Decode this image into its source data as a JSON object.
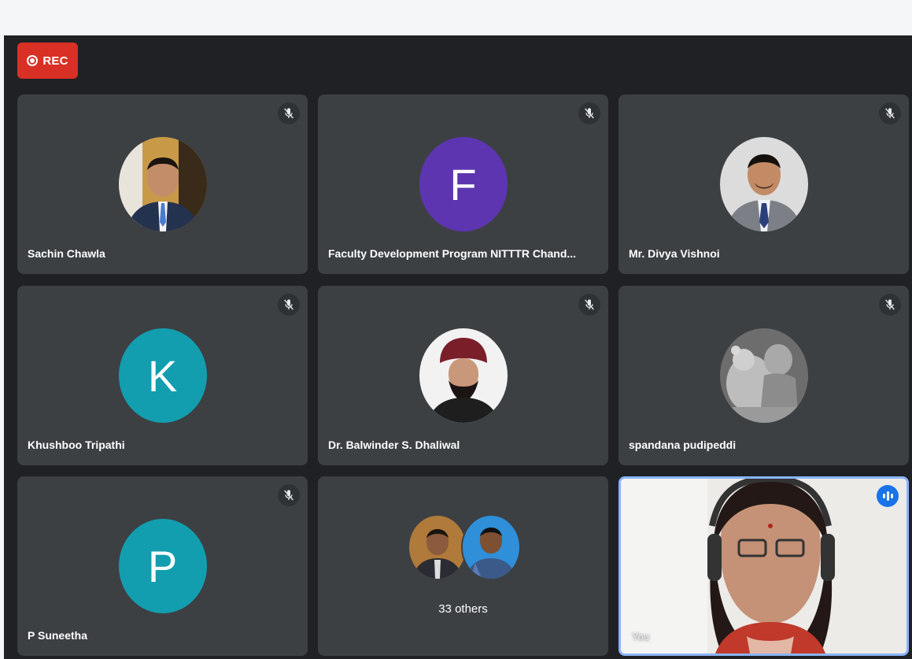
{
  "meeting": {
    "rec_label": "REC"
  },
  "tiles": [
    {
      "name": "Sachin Chawla",
      "type": "photo",
      "muted": true
    },
    {
      "name": "Faculty Development Program NITTTR Chand...",
      "type": "initial",
      "initial": "F",
      "color": "#5e35b1",
      "muted": true
    },
    {
      "name": "Mr. Divya Vishnoi",
      "type": "photo",
      "muted": true
    },
    {
      "name": "Khushboo Tripathi",
      "type": "initial",
      "initial": "K",
      "color": "#129eaf",
      "muted": true
    },
    {
      "name": "Dr. Balwinder S. Dhaliwal",
      "type": "photo",
      "muted": true
    },
    {
      "name": "spandana pudipeddi",
      "type": "photo",
      "muted": true
    },
    {
      "name": "P Suneetha",
      "type": "initial",
      "initial": "P",
      "color": "#129eaf",
      "muted": true
    }
  ],
  "others": {
    "label": "33 others"
  },
  "self": {
    "label": "You",
    "speaking": true
  },
  "colors": {
    "rec": "#d93025",
    "stage": "#202124",
    "tile": "#3c4043",
    "self_border": "#8ab4f8",
    "speaking": "#1a73e8"
  }
}
